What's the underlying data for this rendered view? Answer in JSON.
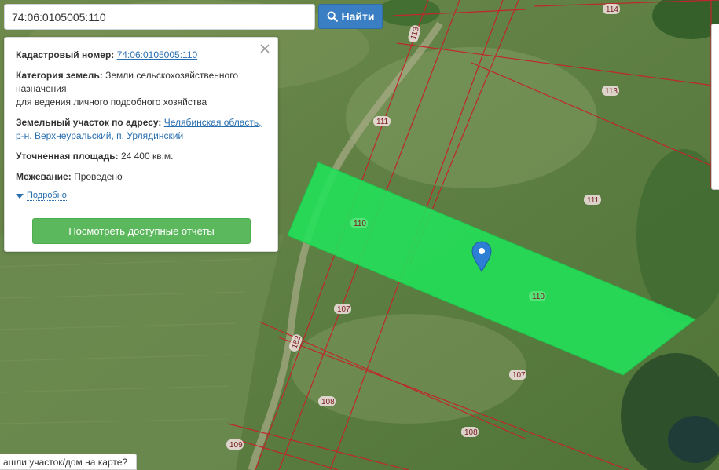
{
  "search": {
    "value": "74:06:0105005:110",
    "button_label": "Найти"
  },
  "info_panel": {
    "cadastral_label": "Кадастровый номер:",
    "cadastral_value": "74:06:0105005:110",
    "land_category_label": "Категория земель:",
    "land_category_value_line1": "Земли сельскохозяйственного назначения",
    "land_category_value_line2": "для ведения личного подсобного хозяйства",
    "address_label": "Земельный участок по адресу:",
    "address_value": "Челябинская область, р-н. Верхнеуральский, п. Урлядинский",
    "area_label": "Уточненная площадь:",
    "area_value": "24 400 кв.м.",
    "survey_label": "Межевание:",
    "survey_value": "Проведено",
    "details_link": "Подробно",
    "reports_button": "Посмотреть доступные отчеты"
  },
  "map": {
    "parcel_labels": [
      "114",
      "113",
      "113",
      "111",
      "111",
      "110",
      "110",
      "107",
      "107",
      "108",
      "108",
      "109",
      "183"
    ],
    "highlight_color": "#22e35a",
    "boundary_color": "#c0262c",
    "marker_color": "#2d7fd6"
  },
  "bottom_hint": "ашли участок/дом на карте?"
}
